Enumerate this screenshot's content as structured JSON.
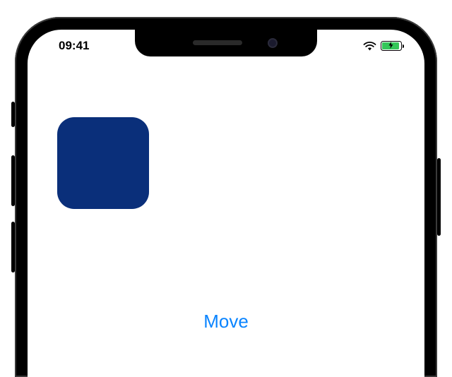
{
  "status_bar": {
    "time": "09:41",
    "wifi_icon": "wifi",
    "battery": {
      "charging": true,
      "level_percent": 90,
      "color": "#34c759"
    }
  },
  "content": {
    "square": {
      "color": "#0a2f7a"
    },
    "move_button_label": "Move",
    "move_button_color": "#0a84ff"
  }
}
